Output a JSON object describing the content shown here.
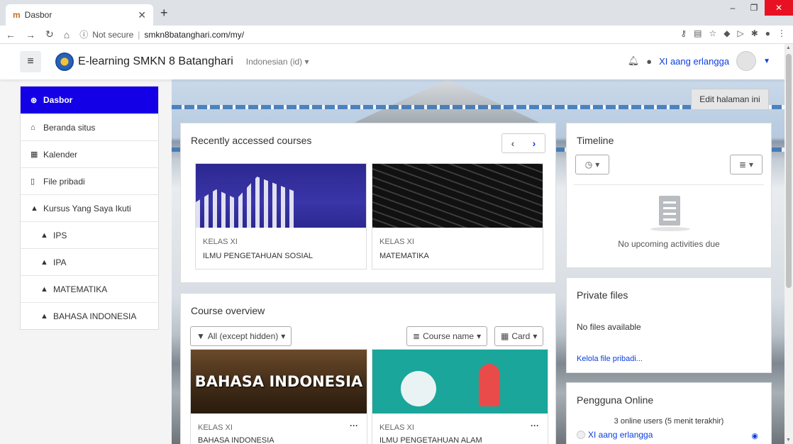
{
  "browser": {
    "tab_title": "Dasbor",
    "tab_favicon": "m",
    "omnibox_security": "Not secure",
    "omnibox_url": "smkn8batanghari.com/my/"
  },
  "header": {
    "site_name": "E-learning SMKN 8 Batanghari",
    "language": "Indonesian (id) ▾",
    "user_name": "XI aang erlangga"
  },
  "edit_page_label": "Edit halaman ini",
  "nav": {
    "items": [
      {
        "label": "Dasbor",
        "icon": "dashboard-icon"
      },
      {
        "label": "Beranda situs",
        "icon": "home-icon"
      },
      {
        "label": "Kalender",
        "icon": "calendar-icon"
      },
      {
        "label": "File pribadi",
        "icon": "file-icon"
      },
      {
        "label": "Kursus Yang Saya Ikuti",
        "icon": "graduation-cap-icon"
      },
      {
        "label": "IPS",
        "icon": "graduation-cap-icon"
      },
      {
        "label": "IPA",
        "icon": "graduation-cap-icon"
      },
      {
        "label": "MATEMATIKA",
        "icon": "graduation-cap-icon"
      },
      {
        "label": "BAHASA INDONESIA",
        "icon": "graduation-cap-icon"
      }
    ]
  },
  "recent": {
    "title": "Recently accessed courses",
    "courses": [
      {
        "category": "KELAS XI",
        "name": "ILMU PENGETAHUAN SOSIAL"
      },
      {
        "category": "KELAS XI",
        "name": "MATEMATIKA"
      }
    ]
  },
  "overview": {
    "title": "Course overview",
    "filter_label": "All (except hidden)",
    "sort_label": "Course name",
    "view_label": "Card",
    "courses": [
      {
        "category": "KELAS XI",
        "name": "BAHASA INDONESIA",
        "image_text": "BAHASA INDONESIA"
      },
      {
        "category": "KELAS XI",
        "name": "ILMU PENGETAHUAN ALAM"
      }
    ]
  },
  "timeline": {
    "title": "Timeline",
    "empty_text": "No upcoming activities due"
  },
  "private_files": {
    "title": "Private files",
    "empty_text": "No files available",
    "manage_link": "Kelola file pribadi..."
  },
  "online_users": {
    "title": "Pengguna Online",
    "summary": "3 online users (5 menit terakhir)",
    "users": [
      "XI aang erlangga"
    ]
  },
  "colors": {
    "accent": "#1400e6",
    "link": "#0a3ee0"
  }
}
